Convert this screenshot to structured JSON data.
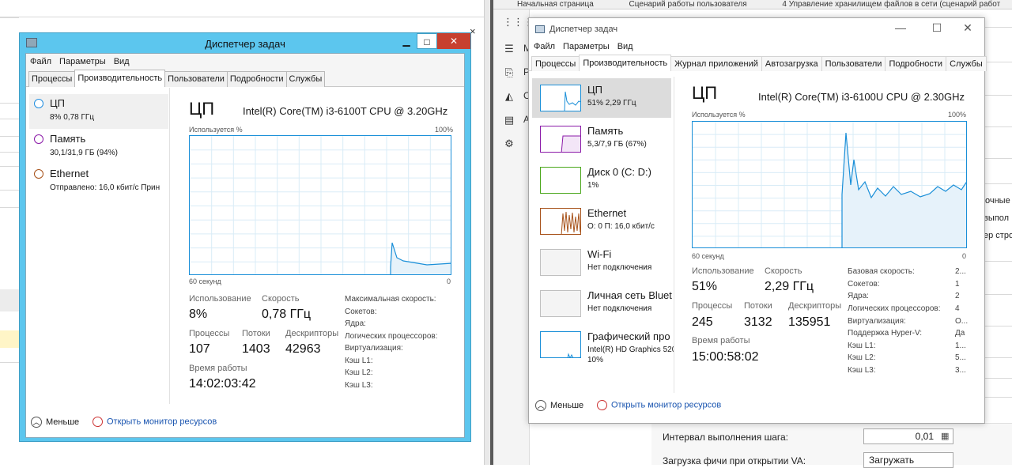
{
  "tm_legacy": {
    "title": "Диспетчер задач",
    "buttons": {
      "minimize": "▁",
      "maximize": "□",
      "close": "✕"
    },
    "menu": [
      "Файл",
      "Параметры",
      "Вид"
    ],
    "tabs": [
      "Процессы",
      "Производительность",
      "Пользователи",
      "Подробности",
      "Службы"
    ],
    "resources": [
      {
        "name": "ЦП",
        "sub": "8% 0,78 ГГц"
      },
      {
        "name": "Память",
        "sub": "30,1/31,9 ГБ (94%)"
      },
      {
        "name": "Ethernet",
        "sub": "Отправлено: 16,0 кбит/с Прин"
      }
    ],
    "header": {
      "title": "ЦП",
      "cpu": "Intel(R) Core(TM) i3-6100T CPU @ 3.20GHz"
    },
    "graph": {
      "top_left": "Используется %",
      "top_right": "100%",
      "bottom_left": "60 секунд",
      "bottom_right": "0"
    },
    "stats": {
      "usage_label": "Использование",
      "usage_value": "8%",
      "speed_label": "Скорость",
      "speed_value": "0,78 ГГц",
      "proc_label": "Процессы",
      "proc_value": "107",
      "threads_label": "Потоки",
      "threads_value": "1403",
      "handles_label": "Дескрипторы",
      "handles_value": "42963",
      "uptime_label": "Время работы",
      "uptime_value": "14:02:03:42"
    },
    "specs": [
      "Максимальная скорость:",
      "Сокетов:",
      "Ядра:",
      "Логических процессоров:",
      "Виртуализация:",
      "Кэш L1:",
      "Кэш L2:",
      "Кэш L3:"
    ],
    "footer": {
      "less": "Меньше",
      "monitor": "Открыть монитор ресурсов"
    }
  },
  "tm_modern": {
    "title": "Диспетчер задач",
    "menu": [
      "Файл",
      "Параметры",
      "Вид"
    ],
    "tabs": [
      "Процессы",
      "Производительность",
      "Журнал приложений",
      "Автозагрузка",
      "Пользователи",
      "Подробности",
      "Службы"
    ],
    "resources": [
      {
        "name": "ЦП",
        "sub": "51% 2,29 ГГц",
        "color": "#1a8fd8"
      },
      {
        "name": "Память",
        "sub": "5,3/7,9 ГБ (67%)",
        "color": "#8b1aa8"
      },
      {
        "name": "Диск 0 (C: D:)",
        "sub": "1%",
        "color": "#4aa71b"
      },
      {
        "name": "Ethernet",
        "sub": "О: 0 П: 16,0 кбит/с",
        "color": "#a7521a"
      },
      {
        "name": "Wi-Fi",
        "sub": "Нет подключения",
        "color": "#c0c0c0"
      },
      {
        "name": "Личная сеть Bluet",
        "sub": "Нет подключения",
        "color": "#c0c0c0"
      },
      {
        "name": "Графический про",
        "sub": "Intel(R) HD Graphics 520",
        "sub2": "10%",
        "color": "#1a8fd8"
      }
    ],
    "header": {
      "title": "ЦП",
      "cpu": "Intel(R) Core(TM) i3-6100U CPU @ 2.30GHz"
    },
    "graph": {
      "top_left": "Используется %",
      "top_right": "100%",
      "bottom_left": "60 секунд",
      "bottom_right": "0"
    },
    "stats": {
      "usage_label": "Использование",
      "usage_value": "51%",
      "speed_label": "Скорость",
      "speed_value": "2,29 ГГц",
      "proc_label": "Процессы",
      "proc_value": "245",
      "threads_label": "Потоки",
      "threads_value": "3132",
      "handles_label": "Дескрипторы",
      "handles_value": "135951",
      "uptime_label": "Время работы",
      "uptime_value": "15:00:58:02"
    },
    "specs": [
      {
        "label": "Базовая скорость:",
        "value": "2..."
      },
      {
        "label": "Сокетов:",
        "value": "1"
      },
      {
        "label": "Ядра:",
        "value": "2"
      },
      {
        "label": "Логических процессоров:",
        "value": "4"
      },
      {
        "label": "Виртуализация:",
        "value": "О..."
      },
      {
        "label": "Поддержка Hyper-V:",
        "value": "Да"
      },
      {
        "label": "Кэш L1:",
        "value": "1..."
      },
      {
        "label": "Кэш L2:",
        "value": "5..."
      },
      {
        "label": "Кэш L3:",
        "value": "3..."
      }
    ],
    "footer": {
      "less": "Меньше",
      "monitor": "Открыть монитор ресурсов"
    }
  },
  "background": {
    "top_tabs": [
      "Начальная страница",
      "Сценарий работы пользователя",
      "4 Управление хранилищем файлов в сети (сценарий работ"
    ],
    "side_labels": [
      "М",
      "Р",
      "С",
      "А"
    ],
    "right_fragments": [
      "очные с",
      "выпол",
      "ер стро"
    ],
    "form": {
      "step_label": "Интервал выполнения шага:",
      "step_value": "0,01",
      "load_label": "Загрузка фичи при открытии VA:",
      "load_value": "Загружать"
    }
  },
  "colors": {
    "cpu": "#1a8fd8",
    "memory": "#8b1aa8",
    "disk": "#4aa71b",
    "ethernet": "#a7521a",
    "win8_frame": "#5cc6ee",
    "close_red": "#c7402f"
  }
}
